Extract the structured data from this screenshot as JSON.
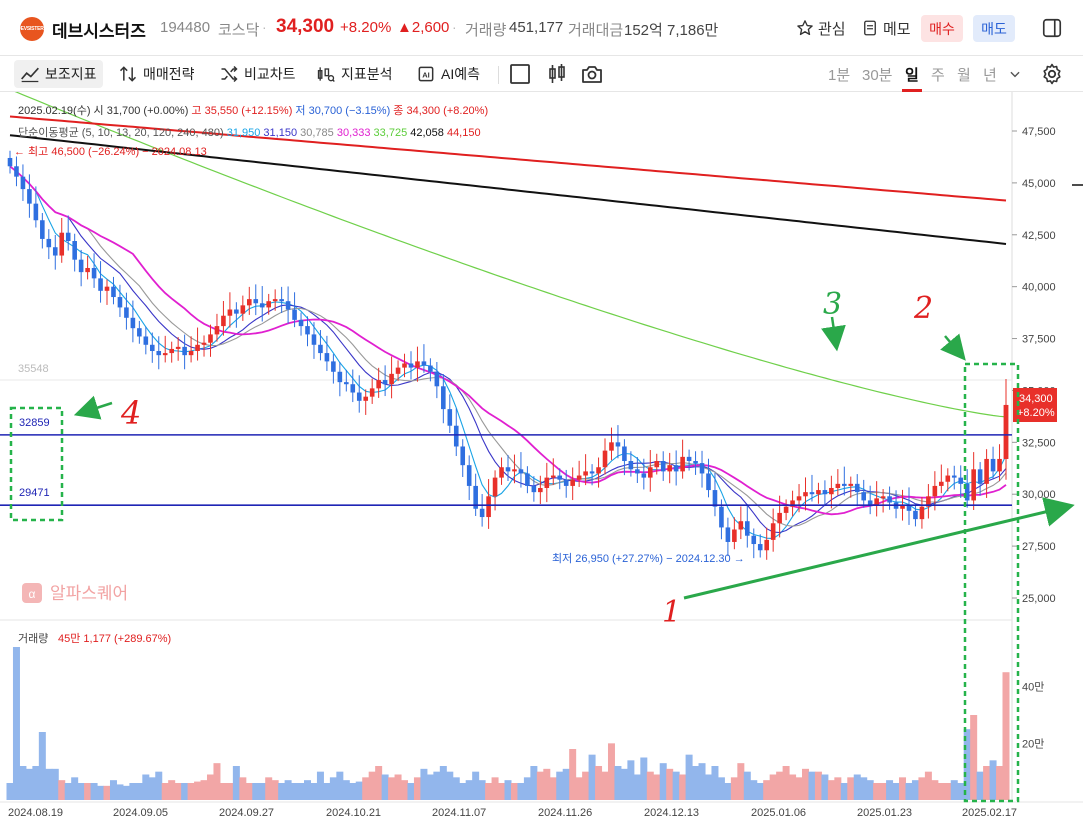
{
  "header": {
    "logo_text": "DEVSISTERS",
    "stock_name": "데브시스터즈",
    "stock_code": "194480",
    "market": "코스닥",
    "price": "34,300",
    "change_pct": "+8.20%",
    "change": "▲2,600",
    "volume_label": "거래량",
    "volume": "451,177",
    "amount_label": "거래대금",
    "amount": "152억 7,186만",
    "watch_label": "관심",
    "memo_label": "메모",
    "buy_label": "매수",
    "sell_label": "매도"
  },
  "toolbar": {
    "aux_indicator": "보조지표",
    "trade_strategy": "매매전략",
    "compare_chart": "비교차트",
    "indicator_analysis": "지표분석",
    "ai_forecast": "AI예측",
    "periods": [
      "1분",
      "30분",
      "일",
      "주",
      "월",
      "년"
    ],
    "active_period": "일"
  },
  "info": {
    "ohlc_line": [
      {
        "text": "2025.02.19(수) 시 31,700 (+0.00%)",
        "color": "#333333"
      },
      {
        "text": "고 35,550 (+12.15%)",
        "color": "#e02020"
      },
      {
        "text": "저 30,700 (−3.15%)",
        "color": "#2a62d6"
      },
      {
        "text": "종 34,300 (+8.20%)",
        "color": "#e02020"
      }
    ],
    "ma_label": "단순이동평균 (5, 10, 13, 20, 120, 240, 480)",
    "ma_values": [
      {
        "text": "31,950",
        "color": "#19a4e6"
      },
      {
        "text": "31,150",
        "color": "#3a36c8"
      },
      {
        "text": "30,785",
        "color": "#888888"
      },
      {
        "text": "30,333",
        "color": "#e020d0"
      },
      {
        "text": "33,725",
        "color": "#5ccd3a"
      },
      {
        "text": "42,058",
        "color": "#111111"
      },
      {
        "text": "44,150",
        "color": "#e02020"
      }
    ],
    "high_note": "← 최고 46,500 (−26.24%) − 2024.08.13",
    "low_note": "최저 26,950 (+27.27%) − 2024.12.30 →",
    "watermark": "알파스퀘어",
    "volume_info_label": "거래량",
    "volume_info_value": "45만 1,177 (+289.67%)"
  },
  "chart_data": {
    "type": "candlestick",
    "price_axis": {
      "ticks": [
        25000,
        27500,
        30000,
        32500,
        35000,
        37500,
        40000,
        42500,
        45000,
        47500
      ],
      "tick_labels": [
        "25,000",
        "27,500",
        "30,000",
        "32,500",
        "35,000",
        "37,500",
        "40,000",
        "42,500",
        "45,000",
        "47,500"
      ],
      "range": [
        23800,
        49500
      ]
    },
    "volume_axis": {
      "ticks": [
        200000,
        400000
      ],
      "tick_labels": [
        "20만",
        "40만"
      ],
      "range": [
        0,
        600000
      ]
    },
    "x_labels": [
      "2024.08.19",
      "2024.09.05",
      "2024.09.27",
      "2024.10.21",
      "2024.11.07",
      "2024.11.26",
      "2024.12.13",
      "2025.01.06",
      "2025.01.23",
      "2025.02.17"
    ],
    "last_price_badge": {
      "price": "34,300",
      "pct": "+8.20%"
    },
    "horizontal_lines": [
      {
        "value": 32859,
        "label": "32859"
      },
      {
        "value": 29471,
        "label": "29471"
      }
    ],
    "level_label": "35548",
    "closes": [
      45800,
      45300,
      44700,
      44000,
      43200,
      42300,
      41900,
      41500,
      42600,
      42200,
      41300,
      40700,
      40900,
      40400,
      39800,
      40000,
      39500,
      39000,
      38500,
      38000,
      37600,
      37200,
      36900,
      36700,
      36800,
      37000,
      37100,
      36700,
      36900,
      37200,
      37300,
      37700,
      38100,
      38600,
      38900,
      38700,
      39100,
      39400,
      39200,
      39000,
      39300,
      39400,
      39300,
      38900,
      38400,
      38100,
      37700,
      37200,
      36800,
      36400,
      35900,
      35400,
      35300,
      34900,
      34500,
      34700,
      35100,
      35500,
      35300,
      35800,
      36100,
      36300,
      36100,
      36400,
      36200,
      35900,
      35200,
      34100,
      33300,
      32300,
      31400,
      30400,
      29300,
      28900,
      29900,
      30800,
      31300,
      31100,
      31200,
      31000,
      30400,
      30100,
      30300,
      30800,
      30900,
      30700,
      30400,
      30700,
      30900,
      31100,
      31000,
      31300,
      32100,
      32500,
      32300,
      31600,
      31200,
      31000,
      30800,
      31300,
      31600,
      31100,
      31400,
      31100,
      31800,
      31600,
      31500,
      31000,
      30200,
      29400,
      28400,
      27700,
      28300,
      28700,
      28000,
      27600,
      27300,
      27800,
      28600,
      29100,
      29400,
      29700,
      29900,
      30100,
      30000,
      30200,
      30000,
      30300,
      30500,
      30400,
      30500,
      30100,
      29700,
      29500,
      29800,
      29900,
      29600,
      29300,
      29500,
      29200,
      28800,
      29400,
      29900,
      30400,
      30600,
      30900,
      30800,
      30500,
      29700,
      31200,
      30500,
      31700,
      31100,
      31700,
      34300
    ],
    "volumes": [
      60,
      540,
      120,
      110,
      120,
      240,
      110,
      110,
      70,
      60,
      80,
      60,
      60,
      60,
      50,
      50,
      70,
      55,
      50,
      60,
      60,
      90,
      80,
      100,
      60,
      70,
      60,
      60,
      60,
      65,
      70,
      90,
      130,
      60,
      60,
      120,
      80,
      60,
      60,
      60,
      80,
      70,
      60,
      70,
      60,
      60,
      70,
      60,
      100,
      60,
      80,
      100,
      70,
      60,
      65,
      80,
      100,
      120,
      90,
      80,
      90,
      70,
      60,
      80,
      110,
      90,
      100,
      120,
      100,
      80,
      60,
      70,
      100,
      70,
      60,
      80,
      60,
      70,
      60,
      60,
      80,
      120,
      100,
      110,
      80,
      100,
      110,
      180,
      80,
      100,
      160,
      120,
      100,
      200,
      120,
      110,
      140,
      90,
      150,
      100,
      90,
      130,
      110,
      100,
      90,
      160,
      120,
      130,
      90,
      120,
      80,
      60,
      80,
      130,
      100,
      70,
      60,
      70,
      90,
      100,
      120,
      90,
      80,
      110,
      100,
      100,
      90,
      70,
      80,
      60,
      80,
      90,
      80,
      70,
      60,
      60,
      70,
      60,
      80,
      60,
      70,
      80,
      100,
      70,
      60,
      60,
      70,
      60,
      250,
      300,
      100,
      120,
      140,
      120,
      451
    ]
  },
  "annotations": {
    "num1": "1",
    "num2": "2",
    "num3": "3",
    "num4": "4"
  }
}
